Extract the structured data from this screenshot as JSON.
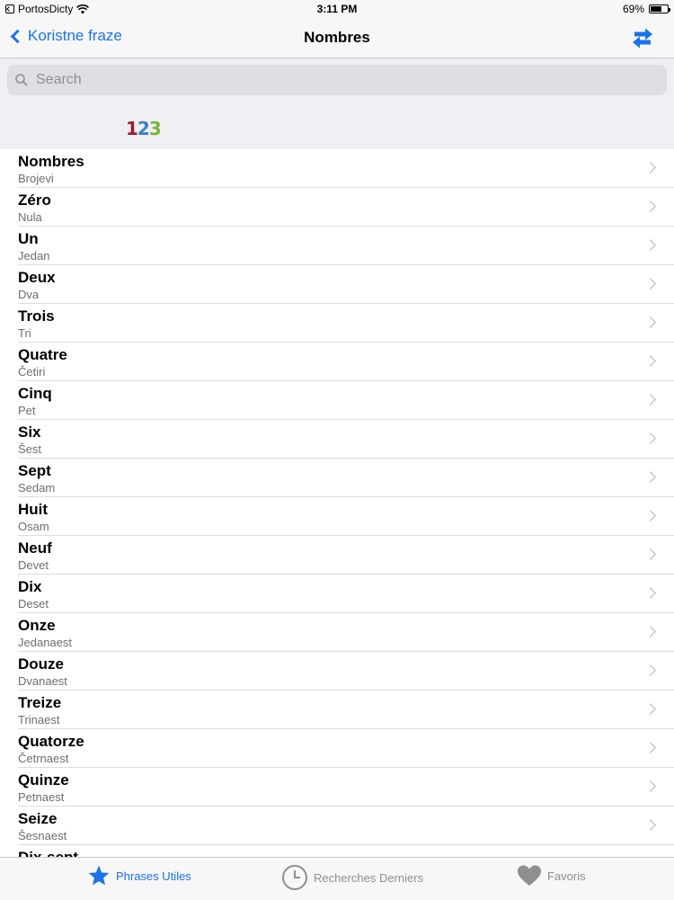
{
  "status_bar": {
    "carrier": "PortosDicty",
    "time": "3:11 PM",
    "battery_percent": "69%",
    "battery_level": 0.69,
    "icons": [
      "back-to-app-icon",
      "wifi-icon",
      "battery-icon"
    ]
  },
  "nav": {
    "back_label": "Koristne fraze",
    "title": "Nombres",
    "swap_icon": "swap-arrows-icon"
  },
  "search": {
    "placeholder": "Search"
  },
  "header": {
    "logo_digits": [
      "1",
      "2",
      "3"
    ]
  },
  "list": {
    "items": [
      {
        "title": "Nombres",
        "subtitle": "Brojevi"
      },
      {
        "title": "Zéro",
        "subtitle": "Nula"
      },
      {
        "title": "Un",
        "subtitle": "Jedan"
      },
      {
        "title": "Deux",
        "subtitle": "Dva"
      },
      {
        "title": "Trois",
        "subtitle": "Tri"
      },
      {
        "title": "Quatre",
        "subtitle": "Četiri"
      },
      {
        "title": "Cinq",
        "subtitle": "Pet"
      },
      {
        "title": "Six",
        "subtitle": "Šest"
      },
      {
        "title": "Sept",
        "subtitle": "Sedam"
      },
      {
        "title": "Huit",
        "subtitle": "Osam"
      },
      {
        "title": "Neuf",
        "subtitle": "Devet"
      },
      {
        "title": "Dix",
        "subtitle": "Deset"
      },
      {
        "title": "Onze",
        "subtitle": "Jedanaest"
      },
      {
        "title": "Douze",
        "subtitle": "Dvanaest"
      },
      {
        "title": "Treize",
        "subtitle": "Trinaest"
      },
      {
        "title": "Quatorze",
        "subtitle": "Četrnaest"
      },
      {
        "title": "Quinze",
        "subtitle": "Petnaest"
      },
      {
        "title": "Seize",
        "subtitle": "Šesnaest"
      },
      {
        "title": "Dix-sept",
        "subtitle": ""
      }
    ]
  },
  "tabbar": {
    "tabs": [
      {
        "label": "Phrases Utiles",
        "icon": "star-icon",
        "active": true
      },
      {
        "label": "Recherches Derniers",
        "icon": "clock-icon",
        "active": false
      },
      {
        "label": "Favoris",
        "icon": "heart-icon",
        "active": false
      }
    ]
  },
  "colors": {
    "accent": "#1a73e8",
    "inactive": "#8e8e93",
    "bar_background": "#f7f7f7",
    "group_background": "#efeff4"
  }
}
